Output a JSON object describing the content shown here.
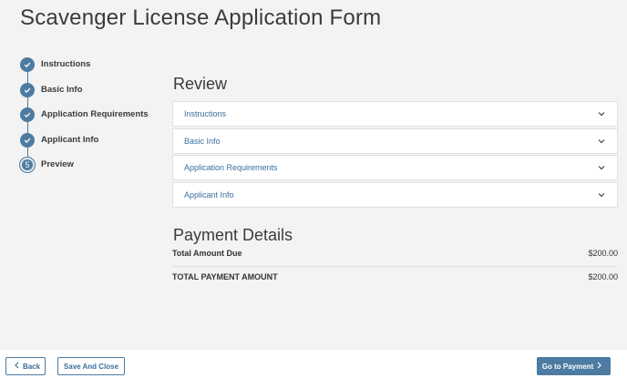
{
  "page": {
    "title": "Scavenger License Application Form"
  },
  "stepper": {
    "steps": [
      {
        "label": "Instructions",
        "status": "done",
        "icon": "check-icon"
      },
      {
        "label": "Basic Info",
        "status": "done",
        "icon": "check-icon"
      },
      {
        "label": "Application Requirements",
        "status": "done",
        "icon": "check-icon"
      },
      {
        "label": "Applicant Info",
        "status": "done",
        "icon": "check-icon"
      },
      {
        "label": "Preview",
        "status": "current",
        "number": "5"
      }
    ]
  },
  "review": {
    "title": "Review",
    "sections": [
      {
        "label": "Instructions"
      },
      {
        "label": "Basic Info"
      },
      {
        "label": "Application Requirements"
      },
      {
        "label": "Applicant Info"
      }
    ]
  },
  "payment": {
    "title": "Payment Details",
    "total_due_label": "Total Amount Due",
    "total_due_value": "$200.00",
    "total_payment_label": "TOTAL PAYMENT AMOUNT",
    "total_payment_value": "$200.00"
  },
  "footer": {
    "back_label": "Back",
    "save_close_label": "Save And Close",
    "go_to_payment_label": "Go to Payment"
  },
  "colors": {
    "accent": "#4d7ba1",
    "link": "#3a6f9d"
  }
}
